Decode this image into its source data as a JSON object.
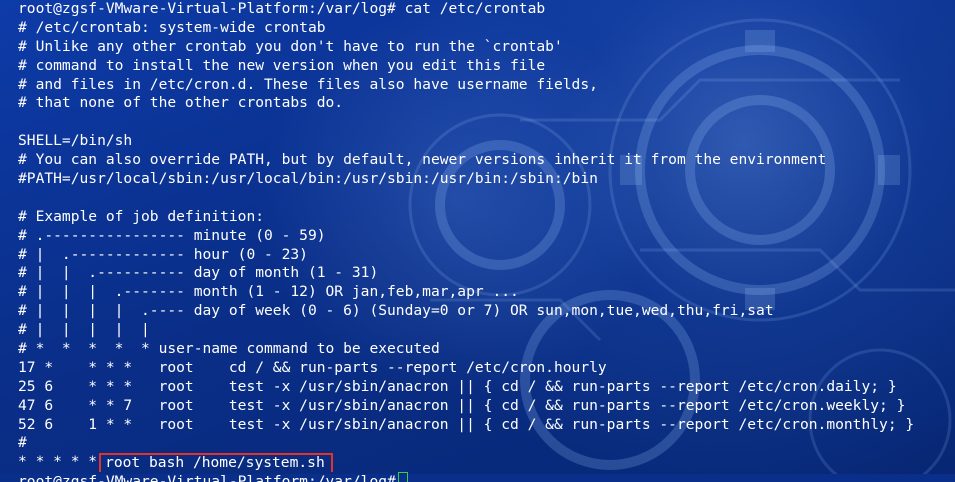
{
  "terminal": {
    "lines": [
      "root@zgsf-VMware-Virtual-Platform:/var/log# cat /etc/crontab",
      "# /etc/crontab: system-wide crontab",
      "# Unlike any other crontab you don't have to run the `crontab'",
      "# command to install the new version when you edit this file",
      "# and files in /etc/cron.d. These files also have username fields,",
      "# that none of the other crontabs do.",
      "",
      "SHELL=/bin/sh",
      "# You can also override PATH, but by default, newer versions inherit it from the environment",
      "#PATH=/usr/local/sbin:/usr/local/bin:/usr/sbin:/usr/bin:/sbin:/bin",
      "",
      "# Example of job definition:",
      "# .---------------- minute (0 - 59)",
      "# |  .------------- hour (0 - 23)",
      "# |  |  .---------- day of month (1 - 31)",
      "# |  |  |  .------- month (1 - 12) OR jan,feb,mar,apr ...",
      "# |  |  |  |  .---- day of week (0 - 6) (Sunday=0 or 7) OR sun,mon,tue,wed,thu,fri,sat",
      "# |  |  |  |  |",
      "# *  *  *  *  * user-name command to be executed",
      "17 *    * * *   root    cd / && run-parts --report /etc/cron.hourly",
      "25 6    * * *   root    test -x /usr/sbin/anacron || { cd / && run-parts --report /etc/cron.daily; }",
      "47 6    * * 7   root    test -x /usr/sbin/anacron || { cd / && run-parts --report /etc/cron.weekly; }",
      "52 6    1 * *   root    test -x /usr/sbin/anacron || { cd / && run-parts --report /etc/cron.monthly; }",
      "#"
    ],
    "suspicious_prefix": "* * * * *",
    "suspicious_entry": "root bash /home/system.sh",
    "next_prompt": "root@zgsf-VMware-Virtual-Platform:/var/log#",
    "highlight_color": "#e3322b",
    "cursor_color": "#38d04a",
    "background_color": "#0a2f8a",
    "text_color": "#ffffff"
  }
}
